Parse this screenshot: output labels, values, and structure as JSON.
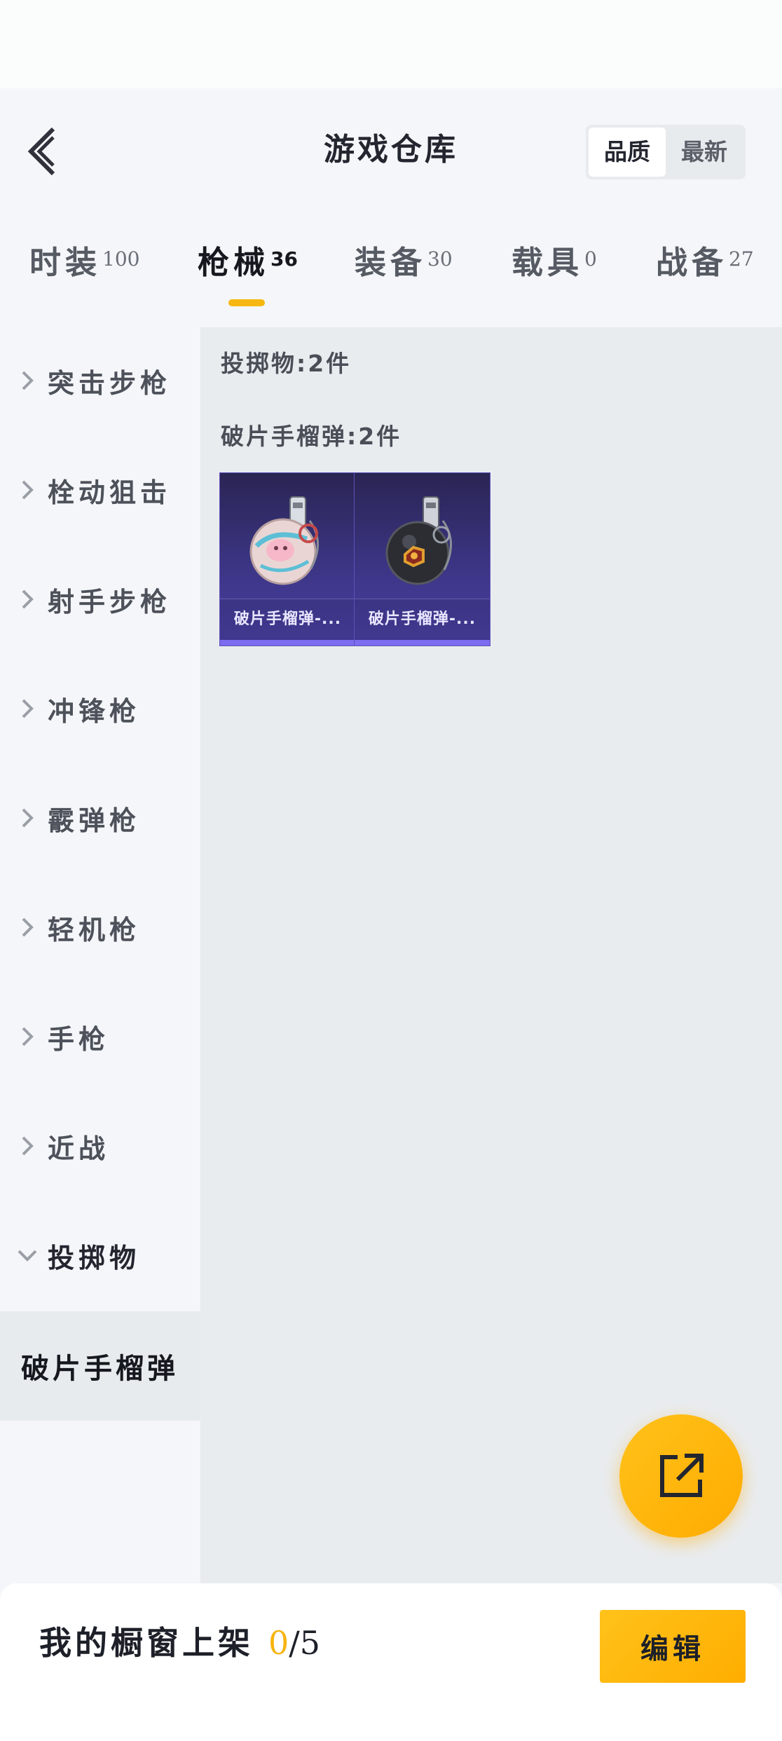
{
  "header": {
    "title": "游戏仓库",
    "sort_options": [
      "品质",
      "最新"
    ]
  },
  "tabs": [
    {
      "label": "时装",
      "count": "100"
    },
    {
      "label": "枪械",
      "count": "36"
    },
    {
      "label": "装备",
      "count": "30"
    },
    {
      "label": "载具",
      "count": "0"
    },
    {
      "label": "战备",
      "count": "27"
    }
  ],
  "sidebar": {
    "items": [
      "突击步枪",
      "栓动狙击",
      "射手步枪",
      "冲锋枪",
      "霰弹枪",
      "轻机枪",
      "手枪",
      "近战",
      "投掷物"
    ],
    "active_sub": "破片手榴弹"
  },
  "content": {
    "category_summary": "投掷物:2件",
    "subcategory_summary": "破片手榴弹:2件",
    "items": [
      {
        "name": "破片手榴弹-...",
        "icon": "pink-grenade-icon"
      },
      {
        "name": "破片手榴弹-...",
        "icon": "black-grenade-icon"
      }
    ]
  },
  "bottom": {
    "showcase_label": "我的橱窗上架",
    "showcase_current": "0",
    "showcase_sep": "/",
    "showcase_max": "5",
    "edit_label": "编辑"
  },
  "colors": {
    "accent": "#f5b710",
    "card_purple": "#3c3585"
  }
}
